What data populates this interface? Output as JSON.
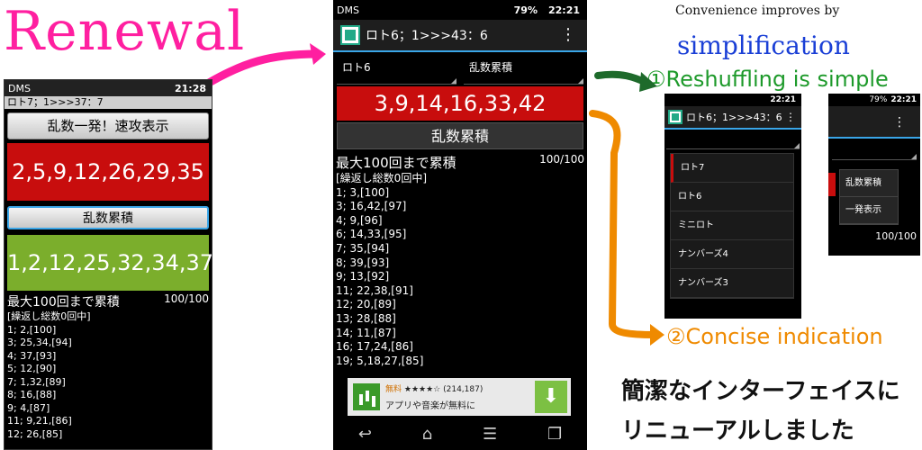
{
  "headline": {
    "renewal": "Renewal",
    "convenience": "Convenience improves by",
    "simplification": "simplification",
    "feature1": "①Reshuffling is simple",
    "feature2": "②Concise indication",
    "japanese_line1": "簡潔なインターフェイスに",
    "japanese_line2": "リニューアルしました"
  },
  "old_phone": {
    "status_time": "21:28",
    "status_icons": "DMS",
    "title": "ロト7；1>>>37：7",
    "button_quick": "乱数一発！速攻表示",
    "red_numbers": "2,5,9,12,26,29,35",
    "button_accumulate": "乱数累積",
    "green_numbers": "1,2,12,25,32,34,37",
    "summary_label": "最大100回まで累積",
    "summary_count": "100/100",
    "list": [
      "[繰返し総数0回中]",
      "1; 2,[100]",
      "3; 25,34,[94]",
      "4; 37,[93]",
      "5; 12,[90]",
      "7; 1,32,[89]",
      "8; 16,[88]",
      "9; 4,[87]",
      "11; 9,21,[86]",
      "12; 26,[85]"
    ]
  },
  "main_phone": {
    "status_time": "22:21",
    "status_battery": "79%",
    "status_icons": "DMS",
    "app_title": "ロト6；1>>>43：6",
    "spinner_game": "ロト6",
    "spinner_mode": "乱数累積",
    "red_numbers": "3,9,14,16,33,42",
    "button_accumulate": "乱数累積",
    "summary_label": "最大100回まで累積",
    "summary_count": "100/100",
    "list": [
      "[繰返し総数0回中]",
      "1; 3,[100]",
      "3; 16,42,[97]",
      "4; 9,[96]",
      "6; 14,33,[95]",
      "7; 35,[94]",
      "8; 39,[93]",
      "9; 13,[92]",
      "11; 22,38,[91]",
      "12; 20,[89]",
      "13; 28,[88]",
      "14; 11,[87]",
      "16; 17,24,[86]",
      "19; 5,18,27,[85]"
    ],
    "ad": {
      "free": "無料",
      "stars": "★★★★☆",
      "reviews": "(214,187)",
      "text": "アプリや音楽が無料に"
    }
  },
  "reshuffle_phone": {
    "status_time": "22:21",
    "app_title": "ロト6；1>>>43：6",
    "spinner_game": "ロト6",
    "options": [
      "ロト7",
      "ロト6",
      "ミニロト",
      "ナンバーズ4",
      "ナンバーズ3"
    ]
  },
  "menu_phone": {
    "status_time": "22:21",
    "status_battery": "79%",
    "spinner_mode": "乱数累積",
    "options": [
      "乱数累積",
      "一発表示"
    ],
    "count": "100/100"
  }
}
